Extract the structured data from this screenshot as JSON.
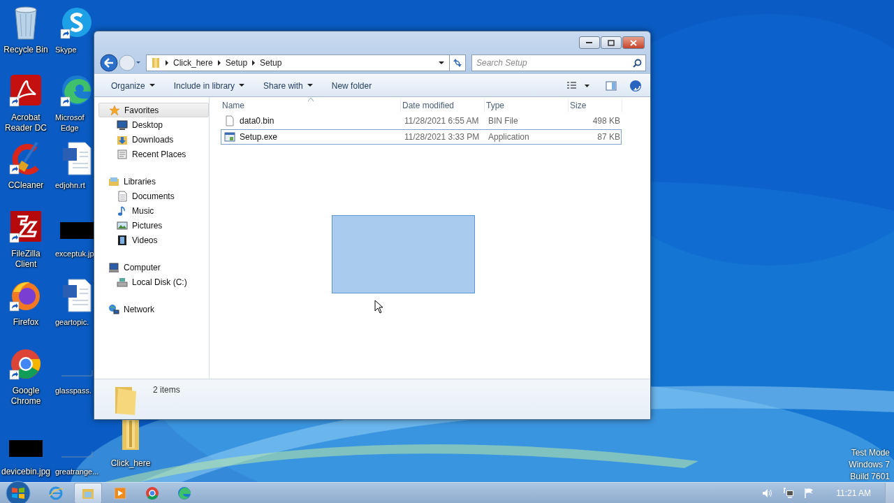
{
  "desktop": {
    "icons": [
      {
        "kind": "recycle-bin",
        "lines": [
          "Recycle Bin"
        ],
        "shortcut": false
      },
      {
        "kind": "skype",
        "lines": [
          "Skype"
        ],
        "shortcut": true
      },
      {
        "kind": "acrobat",
        "lines": [
          "Acrobat",
          "Reader DC"
        ],
        "shortcut": true
      },
      {
        "kind": "edge",
        "lines": [
          "Microsof",
          "Edge"
        ],
        "shortcut": true
      },
      {
        "kind": "ccleaner",
        "lines": [
          "CCleaner"
        ],
        "shortcut": true
      },
      {
        "kind": "word",
        "lines": [
          "edjohn.rt"
        ],
        "shortcut": false
      },
      {
        "kind": "filezilla",
        "lines": [
          "FileZilla",
          "Client"
        ],
        "shortcut": true
      },
      {
        "kind": "dark-image",
        "lines": [
          "exceptuk.jp"
        ],
        "shortcut": false
      },
      {
        "kind": "firefox",
        "lines": [
          "Firefox"
        ],
        "shortcut": true
      },
      {
        "kind": "word",
        "lines": [
          "geartopic."
        ],
        "shortcut": false
      },
      {
        "kind": "chrome",
        "lines": [
          "Google",
          "Chrome"
        ],
        "shortcut": true
      },
      {
        "kind": "blank-image",
        "lines": [
          "glasspass."
        ],
        "shortcut": false
      },
      {
        "kind": "dark-image",
        "lines": [
          "devicebin.jpg"
        ],
        "shortcut": false
      },
      {
        "kind": "blank-image",
        "lines": [
          "greatrange..."
        ],
        "shortcut": false
      },
      {
        "kind": "folder",
        "lines": [
          "Click_here"
        ],
        "shortcut": false
      }
    ],
    "system_notice": [
      "Test Mode",
      "Windows 7",
      "Build 7601"
    ]
  },
  "window": {
    "address": {
      "crumbs": [
        "Click_here",
        "Setup",
        "Setup"
      ]
    },
    "search": {
      "placeholder": "Search Setup"
    },
    "toolbar": [
      {
        "label": "Organize",
        "menu": true
      },
      {
        "label": "Include in library",
        "menu": true
      },
      {
        "label": "Share with",
        "menu": true
      },
      {
        "label": "New folder",
        "menu": false
      }
    ],
    "nav": [
      {
        "kind": "star",
        "label": "Favorites",
        "selected": true,
        "children": [
          {
            "kind": "desktop",
            "label": "Desktop",
            "selected": false
          },
          {
            "kind": "downloads",
            "label": "Downloads",
            "selected": false
          },
          {
            "kind": "recent",
            "label": "Recent Places",
            "selected": false
          }
        ]
      },
      {
        "kind": "library",
        "label": "Libraries",
        "selected": false,
        "children": [
          {
            "kind": "document",
            "label": "Documents",
            "selected": false
          },
          {
            "kind": "music",
            "label": "Music",
            "selected": false
          },
          {
            "kind": "pictures",
            "label": "Pictures",
            "selected": false
          },
          {
            "kind": "video",
            "label": "Videos",
            "selected": false
          }
        ]
      },
      {
        "kind": "computer",
        "label": "Computer",
        "selected": false,
        "children": [
          {
            "kind": "disk",
            "label": "Local Disk (C:)",
            "selected": false
          }
        ]
      },
      {
        "kind": "network",
        "label": "Network",
        "selected": false
      }
    ],
    "columns": [
      {
        "label": "Name",
        "sorted": true
      },
      {
        "label": "Date modified",
        "sorted": false
      },
      {
        "label": "Type",
        "sorted": false
      },
      {
        "label": "Size",
        "sorted": false
      }
    ],
    "rows": [
      {
        "kind": "file",
        "name": "data0.bin",
        "date": "11/28/2021 6:55 AM",
        "type": "BIN File",
        "size": "498 KB",
        "focused": false
      },
      {
        "kind": "exe",
        "name": "Setup.exe",
        "date": "11/28/2021 3:33 PM",
        "type": "Application",
        "size": "87 KB",
        "focused": true
      }
    ],
    "status": {
      "count": "2 items"
    }
  },
  "taskbar": {
    "items": [
      {
        "kind": "ie",
        "active": false
      },
      {
        "kind": "explorer",
        "active": true
      },
      {
        "kind": "media",
        "active": false
      },
      {
        "kind": "chrome",
        "active": false
      },
      {
        "kind": "edge",
        "active": false
      }
    ],
    "tray": [
      {
        "kind": "speaker"
      },
      {
        "kind": "network"
      },
      {
        "kind": "flag"
      }
    ],
    "clock": "11:21 AM"
  }
}
